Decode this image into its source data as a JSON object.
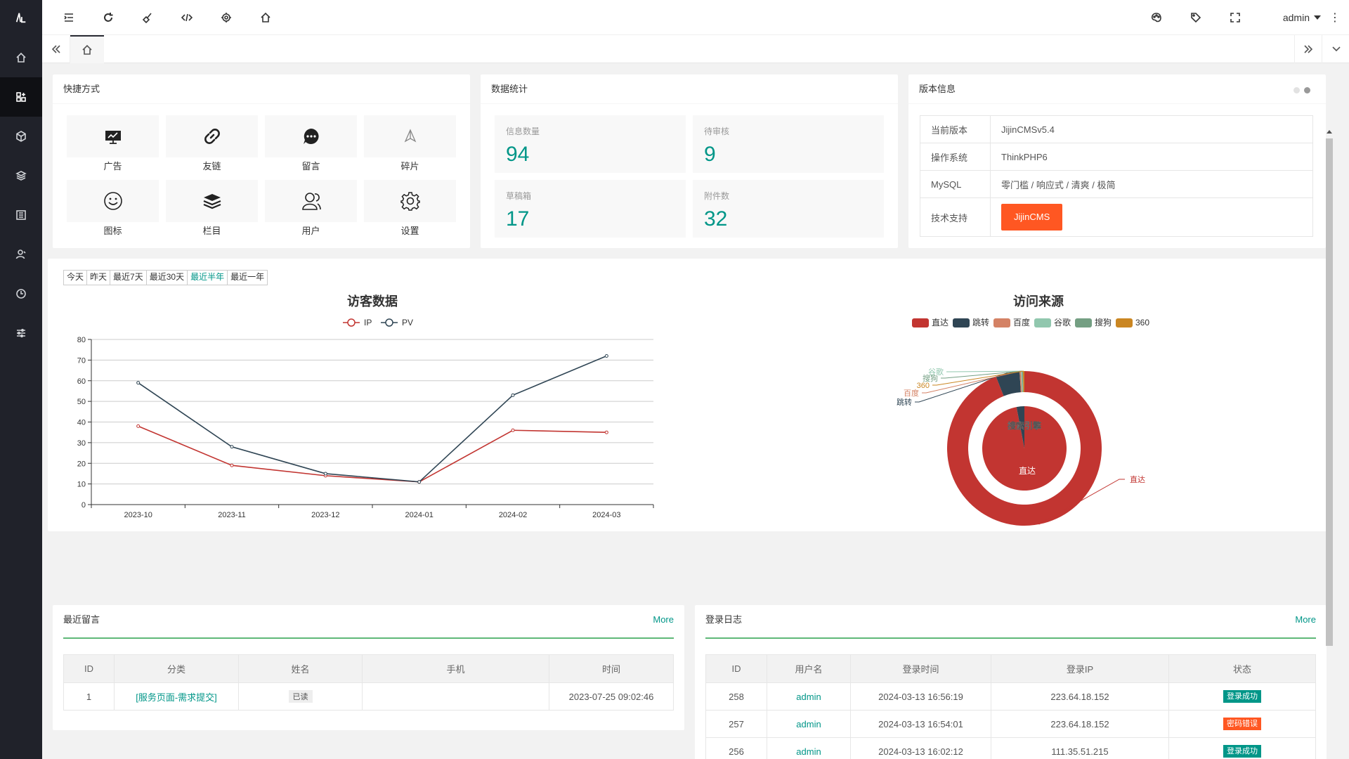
{
  "header": {
    "user": "admin",
    "tools": [
      "menu-toggle-icon",
      "refresh-icon",
      "clean-icon",
      "code-icon",
      "support-icon",
      "home-icon"
    ],
    "right_tools": [
      "theme-icon",
      "tag-icon",
      "fullscreen-icon"
    ]
  },
  "sidebar": {
    "items": [
      "home-icon",
      "dashboard-icon",
      "cube-icon",
      "layers-icon",
      "list-icon",
      "user-icon",
      "clock-icon",
      "settings-sliders-icon"
    ]
  },
  "shortcuts": {
    "title": "快捷方式",
    "items": [
      {
        "label": "广告",
        "icon": "ad-board-icon"
      },
      {
        "label": "友链",
        "icon": "link-icon"
      },
      {
        "label": "留言",
        "icon": "message-icon"
      },
      {
        "label": "碎片",
        "icon": "fragment-icon"
      },
      {
        "label": "图标",
        "icon": "smile-icon"
      },
      {
        "label": "栏目",
        "icon": "layers-icon"
      },
      {
        "label": "用户",
        "icon": "users-icon"
      },
      {
        "label": "设置",
        "icon": "gear-icon"
      }
    ]
  },
  "stats": {
    "title": "数据统计",
    "items": [
      {
        "label": "信息数量",
        "value": "94"
      },
      {
        "label": "待审核",
        "value": "9"
      },
      {
        "label": "草稿箱",
        "value": "17"
      },
      {
        "label": "附件数",
        "value": "32"
      }
    ]
  },
  "version": {
    "title": "版本信息",
    "rows": [
      {
        "key": "当前版本",
        "value": "JijinCMSv5.4"
      },
      {
        "key": "操作系统",
        "value": "ThinkPHP6"
      },
      {
        "key": "MySQL",
        "value": "零门槛 / 响应式 / 清爽 / 极简"
      }
    ],
    "support_key": "技术支持",
    "support_button": "JijinCMS"
  },
  "ranges": [
    "今天",
    "昨天",
    "最近7天",
    "最近30天",
    "最近半年",
    "最近一年"
  ],
  "active_range": "最近半年",
  "chart_data": [
    {
      "type": "line",
      "title": "访客数据",
      "x": [
        "2023-10",
        "2023-11",
        "2023-12",
        "2024-01",
        "2024-02",
        "2024-03"
      ],
      "series": [
        {
          "name": "IP",
          "color": "#c23531",
          "values": [
            38,
            19,
            14,
            11,
            36,
            35
          ]
        },
        {
          "name": "PV",
          "color": "#2f4554",
          "values": [
            59,
            28,
            15,
            11,
            53,
            72
          ]
        }
      ],
      "ylim": [
        0,
        80
      ],
      "yticks": [
        0,
        10,
        20,
        30,
        40,
        50,
        60,
        70,
        80
      ],
      "legend": "top-center",
      "grid": true
    },
    {
      "type": "pie",
      "title": "访问来源",
      "legend": "top-center",
      "outer": [
        {
          "name": "直达",
          "color": "#c23531",
          "value": 94
        },
        {
          "name": "跳转",
          "color": "#2f4554",
          "value": 5
        },
        {
          "name": "百度",
          "color": "#d48265",
          "value": 0.3
        },
        {
          "name": "谷歌",
          "color": "#91c7ae",
          "value": 0.2
        },
        {
          "name": "搜狗",
          "color": "#749f83",
          "value": 0.2
        },
        {
          "name": "360",
          "color": "#ca8622",
          "value": 0.3
        }
      ],
      "inner": [
        {
          "name": "直达",
          "color": "#c23531",
          "value": 97
        },
        {
          "name": "搜索引擎",
          "color": "#2f4554",
          "value": 3
        }
      ]
    }
  ],
  "messages": {
    "title": "最近留言",
    "more": "More",
    "columns": [
      "ID",
      "分类",
      "姓名",
      "手机",
      "时间"
    ],
    "rows": [
      {
        "id": "1",
        "category": "[服务页面-需求提交]",
        "name": "已读",
        "phone": "",
        "time": "2023-07-25 09:02:46"
      }
    ]
  },
  "logins": {
    "title": "登录日志",
    "more": "More",
    "columns": [
      "ID",
      "用户名",
      "登录时间",
      "登录IP",
      "状态"
    ],
    "rows": [
      {
        "id": "258",
        "user": "admin",
        "time": "2024-03-13 16:56:19",
        "ip": "223.64.18.152",
        "status": "登录成功",
        "status_color": "#009688"
      },
      {
        "id": "257",
        "user": "admin",
        "time": "2024-03-13 16:54:01",
        "ip": "223.64.18.152",
        "status": "密码错误",
        "status_color": "#ff5722"
      },
      {
        "id": "256",
        "user": "admin",
        "time": "2024-03-13 16:02:12",
        "ip": "111.35.51.215",
        "status": "登录成功",
        "status_color": "#009688"
      }
    ]
  }
}
